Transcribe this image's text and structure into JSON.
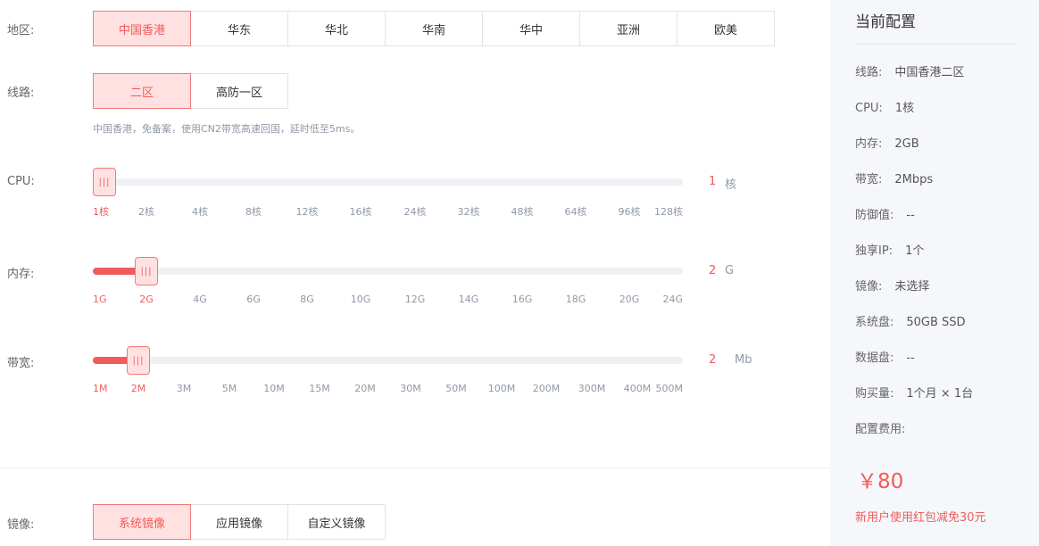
{
  "region": {
    "label": "地区:",
    "options": [
      "中国香港",
      "华东",
      "华北",
      "华南",
      "华中",
      "亚洲",
      "欧美"
    ],
    "selected": 0
  },
  "line": {
    "label": "线路:",
    "options": [
      "二区",
      "高防一区"
    ],
    "selected": 0,
    "hint": "中国香港，免备案，使用CN2带宽高速回国，延时低至5ms。"
  },
  "cpu": {
    "label": "CPU:",
    "ticks": [
      "1核",
      "2核",
      "4核",
      "8核",
      "12核",
      "16核",
      "24核",
      "32核",
      "48核",
      "64核",
      "96核",
      "128核"
    ],
    "selected_index": 0,
    "value": "1",
    "unit": "核",
    "handle_glyph": "|||"
  },
  "memory": {
    "label": "内存:",
    "ticks": [
      "1G",
      "2G",
      "4G",
      "6G",
      "8G",
      "10G",
      "12G",
      "14G",
      "16G",
      "18G",
      "20G",
      "24G"
    ],
    "selected_index": 1,
    "value": "2",
    "unit": "G",
    "handle_glyph": "|||"
  },
  "bandwidth": {
    "label": "带宽:",
    "ticks": [
      "1M",
      "2M",
      "3M",
      "5M",
      "10M",
      "15M",
      "20M",
      "30M",
      "50M",
      "100M",
      "200M",
      "300M",
      "400M",
      "500M"
    ],
    "selected_index": 1,
    "value": "2",
    "unit": "Mb",
    "handle_glyph": "|||"
  },
  "image": {
    "label": "镜像:",
    "options": [
      "系统镜像",
      "应用镜像",
      "自定义镜像"
    ],
    "selected": 0
  },
  "summary": {
    "title": "当前配置",
    "items": [
      {
        "key": "线路:",
        "value": "中国香港二区"
      },
      {
        "key": "CPU:",
        "value": "1核"
      },
      {
        "key": "内存:",
        "value": "2GB"
      },
      {
        "key": "带宽:",
        "value": "2Mbps"
      },
      {
        "key": "防御值:",
        "value": "--"
      },
      {
        "key": "独享IP:",
        "value": "1个"
      },
      {
        "key": "镜像:",
        "value": "未选择"
      },
      {
        "key": "系统盘:",
        "value": "50GB SSD"
      },
      {
        "key": "数据盘:",
        "value": "--"
      },
      {
        "key": "购买量:",
        "value": "1个月 × 1台"
      },
      {
        "key": "配置费用:",
        "value": ""
      }
    ],
    "price": "￥80",
    "promo": "新用户使用红包减免30元"
  },
  "colors": {
    "accent": "#f25b5b",
    "accent_bg": "#ffe1e1",
    "muted": "#8f98a6",
    "panel_bg": "#f5f7fa"
  }
}
